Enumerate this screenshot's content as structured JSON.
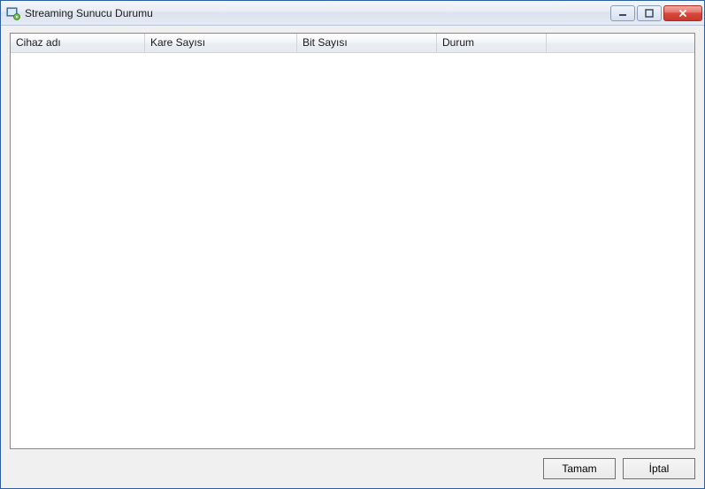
{
  "window": {
    "title": "Streaming Sunucu Durumu"
  },
  "table": {
    "columns": {
      "c0": "Cihaz adı",
      "c1": "Kare Sayısı",
      "c2": "Bit Sayısı",
      "c3": "Durum",
      "c4": ""
    },
    "rows": []
  },
  "buttons": {
    "ok": "Tamam",
    "cancel": "İptal"
  }
}
